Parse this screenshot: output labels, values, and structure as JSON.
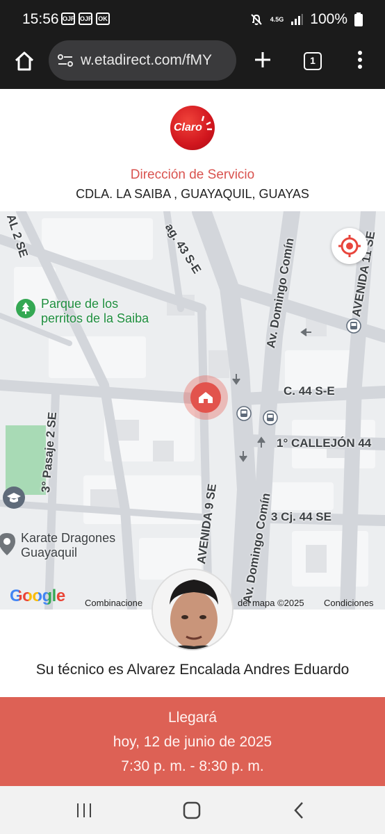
{
  "status_bar": {
    "time": "15:56",
    "notifications": [
      "OJF",
      "OJF",
      "OK"
    ],
    "network": "4.5G",
    "battery": "100%",
    "icons": [
      "mute-icon",
      "signal-icon",
      "battery-icon"
    ]
  },
  "browser": {
    "url": "w.etadirect.com/fMY",
    "tab_count": "1",
    "icons": [
      "home-icon",
      "site-info-icon",
      "new-tab-icon",
      "tabs-icon",
      "menu-icon"
    ]
  },
  "header": {
    "logo_text": "Claro",
    "service_title": "Dirección de Servicio",
    "service_address": "CDLA. LA SAIBA , GUAYAQUIL, GUAYAS"
  },
  "map": {
    "streets": {
      "s1": "AL 2 SE",
      "s2": "ag. 43 S-E",
      "s3": "Av. Domingo Comín",
      "s4": "AVENIDA 11 SE",
      "s5": "C. 44 S-E",
      "s6": "1° CALLEJÓN 44",
      "s7": "3° Pasaje 2 SE",
      "s8": "AVENIDA 9 SE",
      "s9": "Av. Domingo Comín",
      "s10": "3 Cj. 44 SE"
    },
    "places": {
      "park_line1": "Parque de los",
      "park_line2": "perritos de la Saiba",
      "karate_line1": "Karate Dragones",
      "karate_line2": "Guayaquil"
    },
    "google_logo": "Google",
    "attribution_left": "Combinacione",
    "attribution_right": "del mapa ©2025",
    "conditions": "Condiciones",
    "park_color": "#1e8e3e",
    "pin_color": "#e2534d"
  },
  "technician": {
    "text": "Su técnico es Alvarez Encalada Andres Eduardo"
  },
  "arrival": {
    "title": "Llegará",
    "date": "hoy, 12 de junio de 2025",
    "window": "7:30 p. m. - 8:30 p. m.",
    "background": "#dd6155"
  },
  "nav": {
    "icons": [
      "recent-apps-icon",
      "home-nav-icon",
      "back-icon"
    ]
  }
}
